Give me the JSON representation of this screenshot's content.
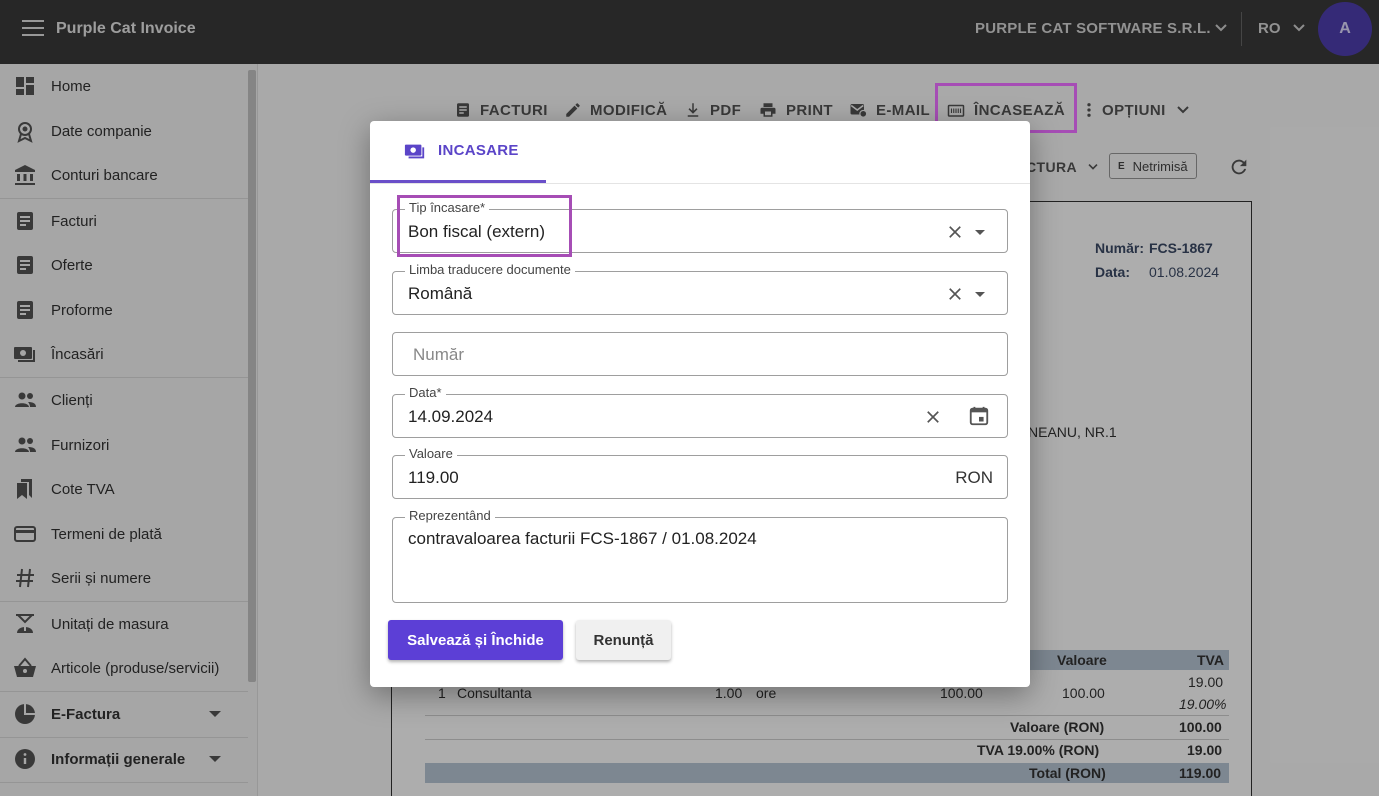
{
  "app": {
    "title": "Purple Cat Invoice"
  },
  "topbar": {
    "company": "PURPLE CAT SOFTWARE S.R.L.",
    "language": "RO",
    "avatar_letter": "A"
  },
  "sidebar": {
    "items": [
      {
        "label": "Home",
        "icon": "dashboard-icon"
      },
      {
        "label": "Date companie",
        "icon": "badge-icon"
      },
      {
        "label": "Conturi bancare",
        "icon": "bank-icon"
      },
      {
        "label": "Facturi",
        "icon": "document-icon"
      },
      {
        "label": "Oferte",
        "icon": "document-icon"
      },
      {
        "label": "Proforme",
        "icon": "document-icon"
      },
      {
        "label": "Încasări",
        "icon": "payments-icon"
      },
      {
        "label": "Clienți",
        "icon": "people-icon"
      },
      {
        "label": "Furnizori",
        "icon": "people-icon"
      },
      {
        "label": "Cote TVA",
        "icon": "bookmarks-icon"
      },
      {
        "label": "Termeni de plată",
        "icon": "credit-card-icon"
      },
      {
        "label": "Serii și numere",
        "icon": "hash-icon"
      },
      {
        "label": "Unitați de masura",
        "icon": "scale-icon"
      },
      {
        "label": "Articole (produse/servicii)",
        "icon": "basket-icon"
      },
      {
        "label": "E-Factura",
        "icon": "pie-chart-icon"
      },
      {
        "label": "Informații generale",
        "icon": "info-icon"
      }
    ]
  },
  "toolbar": {
    "facturi": "FACTURI",
    "modifica": "MODIFICĂ",
    "pdf": "PDF",
    "print": "PRINT",
    "email": "E-MAIL",
    "incaseaza": "ÎNCASEAZĂ",
    "optiuni": "OPȚIUNI",
    "efactura_partial": "CTURA",
    "netrimisa_letter": "E",
    "netrimisa": "Netrimisă"
  },
  "invoice": {
    "numar_label": "Număr:",
    "numar": "FCS-1867",
    "data_label": "Data:",
    "data": "01.08.2024",
    "address_partial": "NEANU, NR.1",
    "col_valoare": "Valoare",
    "col_tva": "TVA",
    "row": {
      "nr": "1",
      "descriere": "Consultanta",
      "cantitate": "1.00",
      "um": "ore",
      "pret": "100.00",
      "valoare": "100.00",
      "tva": "19.00",
      "tva_rate": "19.00%"
    },
    "totals": [
      {
        "label": "Valoare (RON)",
        "value": "100.00"
      },
      {
        "label": "TVA 19.00% (RON)",
        "value": "19.00"
      },
      {
        "label": "Total (RON)",
        "value": "119.00"
      }
    ]
  },
  "dialog": {
    "tab": "INCASARE",
    "tip": {
      "label": "Tip încasare*",
      "value": "Bon fiscal (extern)"
    },
    "limba": {
      "label": "Limba traducere documente",
      "value": "Română"
    },
    "numar": {
      "placeholder": "Număr"
    },
    "data": {
      "label": "Data*",
      "value": "14.09.2024"
    },
    "valoare": {
      "label": "Valoare",
      "value": "119.00",
      "currency": "RON"
    },
    "reprezentand": {
      "label": "Reprezentând",
      "value": "contravaloarea facturii FCS-1867 / 01.08.2024"
    },
    "save": "Salvează și Închide",
    "cancel": "Renunță"
  },
  "colors": {
    "accent": "#5c3fd6",
    "highlight": "#a64db5",
    "topbar": "#3a3a3a"
  }
}
